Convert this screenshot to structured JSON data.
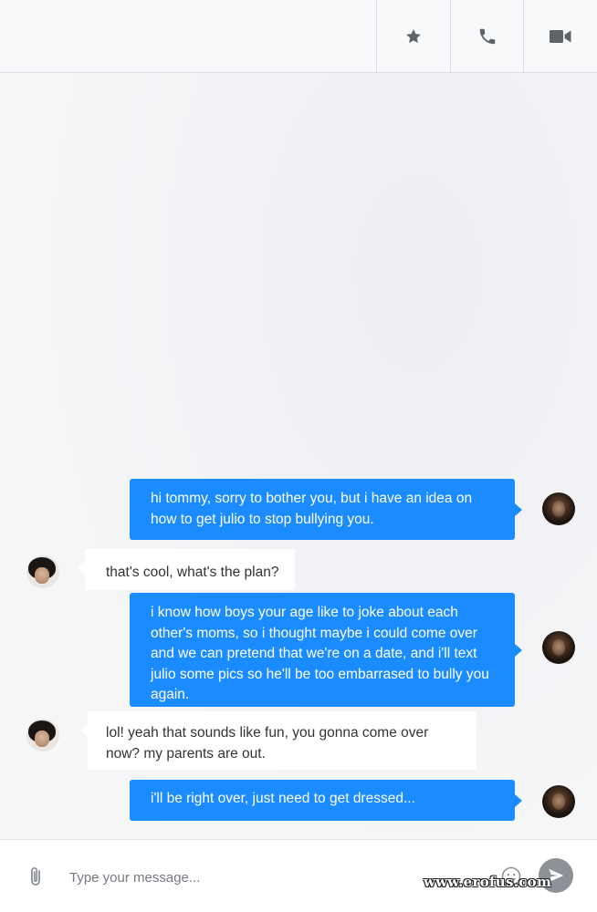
{
  "header": {
    "icons": [
      "star-icon",
      "phone-icon",
      "video-camera-icon"
    ]
  },
  "messages": [
    {
      "sender": "mom",
      "direction": "out",
      "text": "hi tommy, sorry to bother you, but i have an idea on how to get julio to stop bullying you."
    },
    {
      "sender": "tommy",
      "direction": "in",
      "text": "that's cool, what's the plan?"
    },
    {
      "sender": "mom",
      "direction": "out",
      "text": "i know how boys your age like to joke about each other's moms, so i thought maybe i could come over and we can pretend that we're on a date, and i'll text julio some pics so he'll be too embarrased to bully you again."
    },
    {
      "sender": "tommy",
      "direction": "in",
      "text": "lol! yeah that sounds like fun, you gonna come over now? my parents are out."
    },
    {
      "sender": "mom",
      "direction": "out",
      "text": "i'll be right over, just need to get dressed..."
    }
  ],
  "composer": {
    "placeholder": "Type your message...",
    "value": ""
  },
  "watermark": "www.erofus.com",
  "colors": {
    "outgoing_bubble": "#1a8cff",
    "incoming_bubble": "#ffffff",
    "send_button": "#8d9298"
  }
}
